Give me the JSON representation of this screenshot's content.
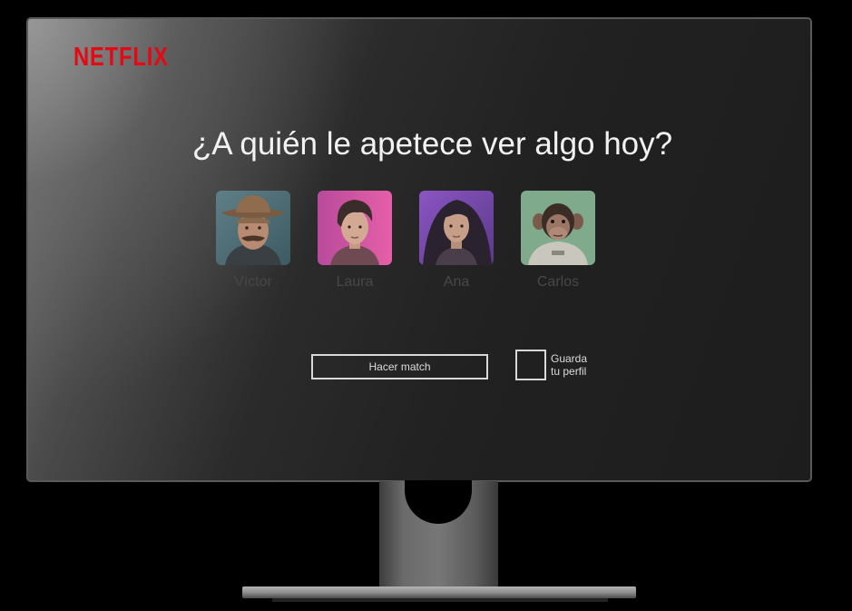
{
  "brand": {
    "logo_text": "NETFLIX",
    "color": "#e50914"
  },
  "heading": "¿A quién le apetece ver algo hoy?",
  "profiles": [
    {
      "name": "Víctor",
      "avatar": "man-hat-mustache"
    },
    {
      "name": "Laura",
      "avatar": "woman-short-hair-pink-bg"
    },
    {
      "name": "Ana",
      "avatar": "woman-curly-hair-purple-bg"
    },
    {
      "name": "Carlos",
      "avatar": "chimpanzee-green-bg"
    }
  ],
  "actions": {
    "match_label": "Hacer match",
    "save_label_line1": "Guarda",
    "save_label_line2": "tu perfil"
  }
}
